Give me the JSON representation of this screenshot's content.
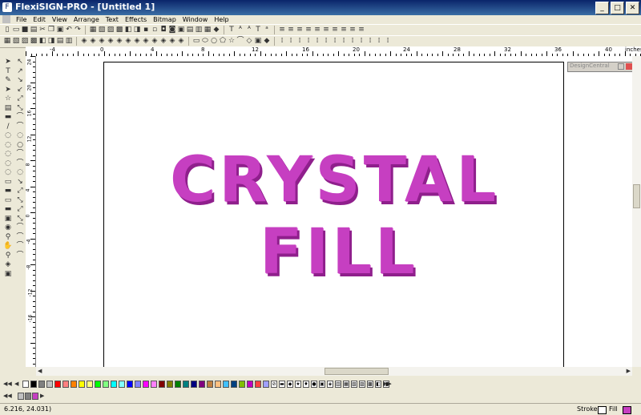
{
  "window": {
    "title": "FlexiSIGN-PRO - [Untitled 1]",
    "minimize": "_",
    "maximize": "□",
    "close": "✕"
  },
  "menu": [
    "File",
    "Edit",
    "View",
    "Arrange",
    "Text",
    "Effects",
    "Bitmap",
    "Window",
    "Help"
  ],
  "ruler_h": {
    "labels": [
      "-4",
      "0",
      "4",
      "8",
      "12",
      "16",
      "20",
      "24",
      "28",
      "32",
      "36",
      "40",
      "inches"
    ]
  },
  "ruler_v": {
    "labels": [
      "24",
      "20",
      "16",
      "12",
      "8",
      "4",
      "0",
      "-4",
      "-8",
      "-12",
      "-16"
    ]
  },
  "canvas": {
    "line1": "CRYSTAL",
    "line2": "FILL"
  },
  "design_central": {
    "title": "DesignCentral"
  },
  "status": {
    "coords": "6.216, 24.031)",
    "stroke": "Stroke",
    "fill": "Fill"
  },
  "colors": {
    "palette": [
      "#ffffff",
      "#000000",
      "#808080",
      "#c0c0c0",
      "#ff0000",
      "#ff8080",
      "#ff8000",
      "#ffff00",
      "#ffff80",
      "#00ff00",
      "#80ff80",
      "#00ffff",
      "#80ffff",
      "#0000ff",
      "#8080ff",
      "#ff00ff",
      "#ff80ff",
      "#800000",
      "#808000",
      "#008000",
      "#008080",
      "#000080",
      "#800080",
      "#c08040",
      "#ffc080",
      "#40c0ff",
      "#004080",
      "#80c000",
      "#c000c0",
      "#ff4040",
      "#a0a0ff"
    ],
    "accent": "#c63fc1"
  }
}
